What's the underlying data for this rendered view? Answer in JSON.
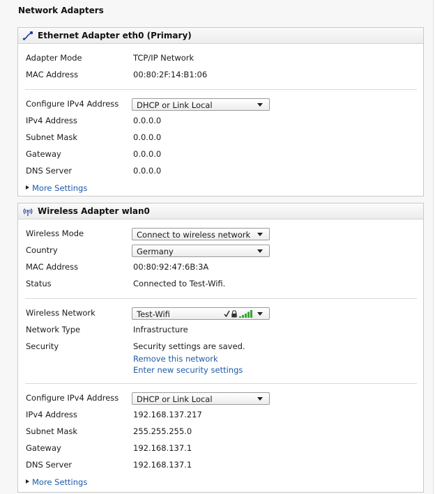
{
  "page": {
    "title": "Network Adapters"
  },
  "ethernet": {
    "title": "Ethernet Adapter eth0 (Primary)",
    "icon": "ethernet-cable-icon",
    "adapter_mode_label": "Adapter Mode",
    "adapter_mode_value": "TCP/IP Network",
    "mac_label": "MAC Address",
    "mac_value": "00:80:2F:14:B1:06",
    "configure_label": "Configure IPv4 Address",
    "configure_value": "DHCP or Link Local",
    "ipv4_label": "IPv4 Address",
    "ipv4_value": "0.0.0.0",
    "subnet_label": "Subnet Mask",
    "subnet_value": "0.0.0.0",
    "gateway_label": "Gateway",
    "gateway_value": "0.0.0.0",
    "dns_label": "DNS Server",
    "dns_value": "0.0.0.0",
    "more_settings": "More Settings"
  },
  "wireless": {
    "title": "Wireless Adapter wlan0",
    "icon": "wireless-antenna-icon",
    "mode_label": "Wireless Mode",
    "mode_value": "Connect to wireless network",
    "country_label": "Country",
    "country_value": "Germany",
    "mac_label": "MAC Address",
    "mac_value": "00:80:92:47:6B:3A",
    "status_label": "Status",
    "status_value": "Connected to Test-Wifi.",
    "network_label": "Wireless Network",
    "network_value": "Test-Wifi",
    "network_type_label": "Network Type",
    "network_type_value": "Infrastructure",
    "security_label": "Security",
    "security_value": "Security settings are saved.",
    "remove_link": "Remove this network",
    "enter_link": "Enter new security settings",
    "configure_label": "Configure IPv4 Address",
    "configure_value": "DHCP or Link Local",
    "ipv4_label": "IPv4 Address",
    "ipv4_value": "192.168.137.217",
    "subnet_label": "Subnet Mask",
    "subnet_value": "255.255.255.0",
    "gateway_label": "Gateway",
    "gateway_value": "192.168.137.1",
    "dns_label": "DNS Server",
    "dns_value": "192.168.137.1",
    "more_settings": "More Settings"
  },
  "colors": {
    "link": "#1d5aa8",
    "signal": "#3aa53a"
  }
}
